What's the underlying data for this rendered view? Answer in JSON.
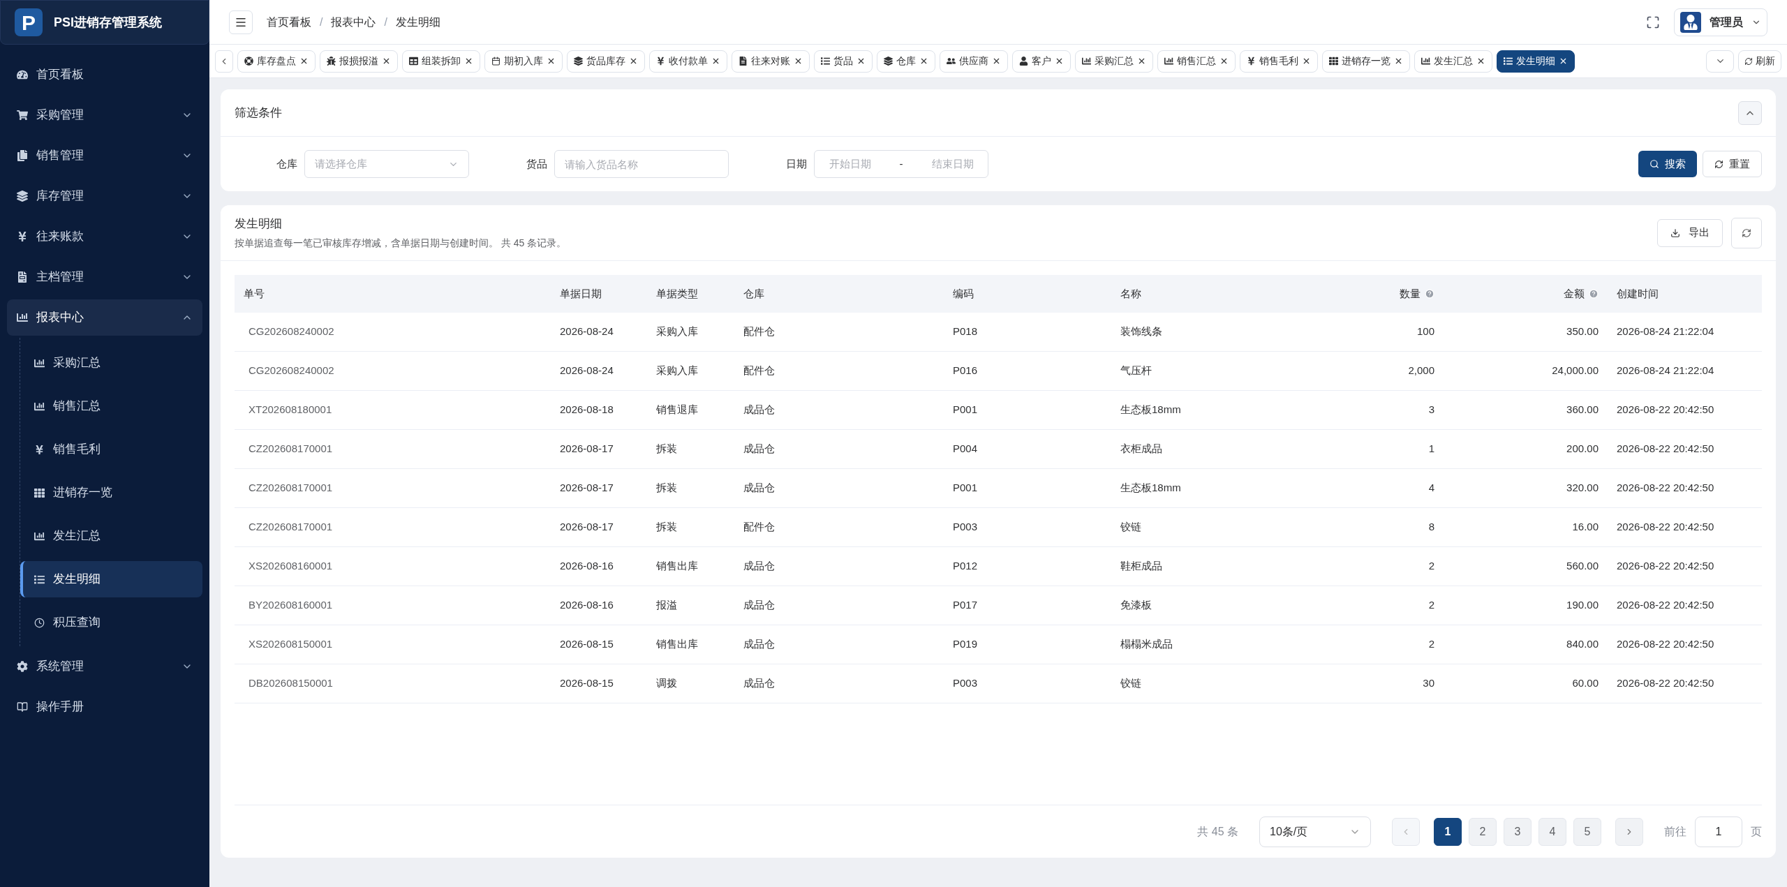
{
  "app": {
    "logo_letter": "P",
    "title": "PSI进销存管理系统"
  },
  "sidebar": {
    "items": [
      {
        "label": "首页看板",
        "kind": "link"
      },
      {
        "label": "采购管理",
        "kind": "group",
        "expanded": false
      },
      {
        "label": "销售管理",
        "kind": "group",
        "expanded": false
      },
      {
        "label": "库存管理",
        "kind": "group",
        "expanded": false
      },
      {
        "label": "往来账款",
        "kind": "group",
        "expanded": false
      },
      {
        "label": "主档管理",
        "kind": "group",
        "expanded": false
      },
      {
        "label": "报表中心",
        "kind": "group",
        "expanded": true,
        "children": [
          {
            "label": "采购汇总",
            "selected": false
          },
          {
            "label": "销售汇总",
            "selected": false
          },
          {
            "label": "销售毛利",
            "selected": false
          },
          {
            "label": "进销存一览",
            "selected": false
          },
          {
            "label": "发生汇总",
            "selected": false
          },
          {
            "label": "发生明细",
            "selected": true
          },
          {
            "label": "积压查询",
            "selected": false
          }
        ]
      },
      {
        "label": "系统管理",
        "kind": "group",
        "expanded": false
      },
      {
        "label": "操作手册",
        "kind": "link"
      }
    ]
  },
  "header": {
    "breadcrumb": [
      "首页看板",
      "报表中心",
      "发生明细"
    ],
    "separator": "/",
    "user": "管理员"
  },
  "tabs": [
    {
      "label": "库存盘点",
      "selected": false
    },
    {
      "label": "报损报溢",
      "selected": false
    },
    {
      "label": "组装拆卸",
      "selected": false
    },
    {
      "label": "期初入库",
      "selected": false
    },
    {
      "label": "货品库存",
      "selected": false
    },
    {
      "label": "收付款单",
      "selected": false
    },
    {
      "label": "往来对账",
      "selected": false
    },
    {
      "label": "货品",
      "selected": false
    },
    {
      "label": "仓库",
      "selected": false
    },
    {
      "label": "供应商",
      "selected": false
    },
    {
      "label": "客户",
      "selected": false
    },
    {
      "label": "采购汇总",
      "selected": false
    },
    {
      "label": "销售汇总",
      "selected": false
    },
    {
      "label": "销售毛利",
      "selected": false
    },
    {
      "label": "进销存一览",
      "selected": false
    },
    {
      "label": "发生汇总",
      "selected": false
    },
    {
      "label": "发生明细",
      "selected": true
    }
  ],
  "tab_refresh": "刷新",
  "filter": {
    "title": "筛选条件",
    "expanded": true,
    "warehouse": {
      "label": "仓库",
      "placeholder": "请选择仓库"
    },
    "goods": {
      "label": "货品",
      "placeholder": "请输入货品名称"
    },
    "date": {
      "label": "日期",
      "start_placeholder": "开始日期",
      "separator": "-",
      "end_placeholder": "结束日期"
    },
    "search_button": "搜索",
    "reset_button": "重置"
  },
  "report": {
    "title": "发生明细",
    "description": "按单据追查每一笔已审核库存增减，含单据日期与创建时间。 共 45 条记录。",
    "export_button": "导出",
    "columns": [
      {
        "label": "单号",
        "help": false
      },
      {
        "label": "单据日期",
        "help": false
      },
      {
        "label": "单据类型",
        "help": false
      },
      {
        "label": "仓库",
        "help": false
      },
      {
        "label": "编码",
        "help": false
      },
      {
        "label": "名称",
        "help": false
      },
      {
        "label": "数量",
        "help": true
      },
      {
        "label": "金额",
        "help": true
      },
      {
        "label": "创建时间",
        "help": false
      }
    ],
    "rows": [
      [
        "CG202608240002",
        "2026-08-24",
        "采购入库",
        "配件仓",
        "P018",
        "装饰线条",
        "100",
        "350.00",
        "2026-08-24 21:22:04"
      ],
      [
        "CG202608240002",
        "2026-08-24",
        "采购入库",
        "配件仓",
        "P016",
        "气压杆",
        "2,000",
        "24,000.00",
        "2026-08-24 21:22:04"
      ],
      [
        "XT202608180001",
        "2026-08-18",
        "销售退库",
        "成品仓",
        "P001",
        "生态板18mm",
        "3",
        "360.00",
        "2026-08-22 20:42:50"
      ],
      [
        "CZ202608170001",
        "2026-08-17",
        "拆装",
        "成品仓",
        "P004",
        "衣柜成品",
        "1",
        "200.00",
        "2026-08-22 20:42:50"
      ],
      [
        "CZ202608170001",
        "2026-08-17",
        "拆装",
        "成品仓",
        "P001",
        "生态板18mm",
        "4",
        "320.00",
        "2026-08-22 20:42:50"
      ],
      [
        "CZ202608170001",
        "2026-08-17",
        "拆装",
        "配件仓",
        "P003",
        "铰链",
        "8",
        "16.00",
        "2026-08-22 20:42:50"
      ],
      [
        "XS202608160001",
        "2026-08-16",
        "销售出库",
        "成品仓",
        "P012",
        "鞋柜成品",
        "2",
        "560.00",
        "2026-08-22 20:42:50"
      ],
      [
        "BY202608160001",
        "2026-08-16",
        "报溢",
        "成品仓",
        "P017",
        "免漆板",
        "2",
        "190.00",
        "2026-08-22 20:42:50"
      ],
      [
        "XS202608150001",
        "2026-08-15",
        "销售出库",
        "成品仓",
        "P019",
        "榻榻米成品",
        "2",
        "840.00",
        "2026-08-22 20:42:50"
      ],
      [
        "DB202608150001",
        "2026-08-15",
        "调拨",
        "成品仓",
        "P003",
        "铰链",
        "30",
        "60.00",
        "2026-08-22 20:42:50"
      ]
    ]
  },
  "pagination": {
    "total": "共 45 条",
    "page_size": "10条/页",
    "pages": [
      {
        "label": "1",
        "selected": true
      },
      {
        "label": "2",
        "selected": false
      },
      {
        "label": "3",
        "selected": false
      },
      {
        "label": "4",
        "selected": false
      },
      {
        "label": "5",
        "selected": false
      }
    ],
    "goto_label": "前往",
    "goto_value": "1",
    "goto_unit": "页"
  }
}
